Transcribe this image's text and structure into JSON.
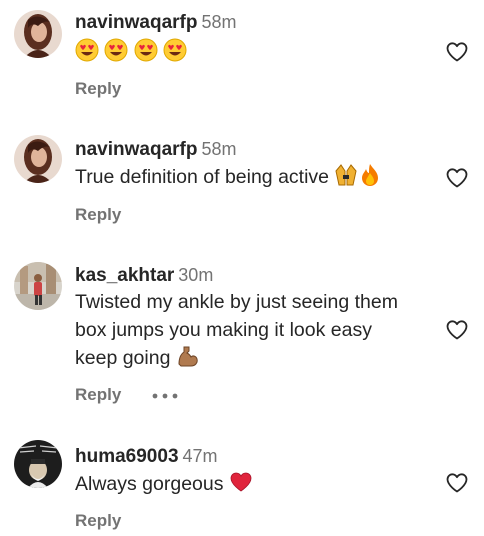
{
  "comments": [
    {
      "username": "navinwaqarfp",
      "time": "58m",
      "text": "",
      "reply_label": "Reply",
      "emojis": [
        "heart-eyes-emoji",
        "heart-eyes-emoji",
        "heart-eyes-emoji",
        "heart-eyes-emoji"
      ]
    },
    {
      "username": "navinwaqarfp",
      "time": "58m",
      "text": "True definition of being active",
      "reply_label": "Reply",
      "emojis": [
        "raising-hands-emoji",
        "fire-emoji"
      ]
    },
    {
      "username": "kas_akhtar",
      "time": "30m",
      "text_lines": [
        "Twisted my ankle by just seeing them",
        "box jumps you making it look easy",
        "keep going"
      ],
      "reply_label": "Reply",
      "emojis": [
        "flexed-biceps-emoji"
      ]
    },
    {
      "username": "huma69003",
      "time": "47m",
      "text": "Always gorgeous",
      "reply_label": "Reply",
      "emojis": [
        "red-heart-emoji"
      ]
    }
  ],
  "colors": {
    "text": "#262626",
    "secondary": "#737373",
    "heart_outline": "#262626"
  },
  "icons": {
    "like": "heart-outline-icon",
    "more": "more-options-icon"
  }
}
